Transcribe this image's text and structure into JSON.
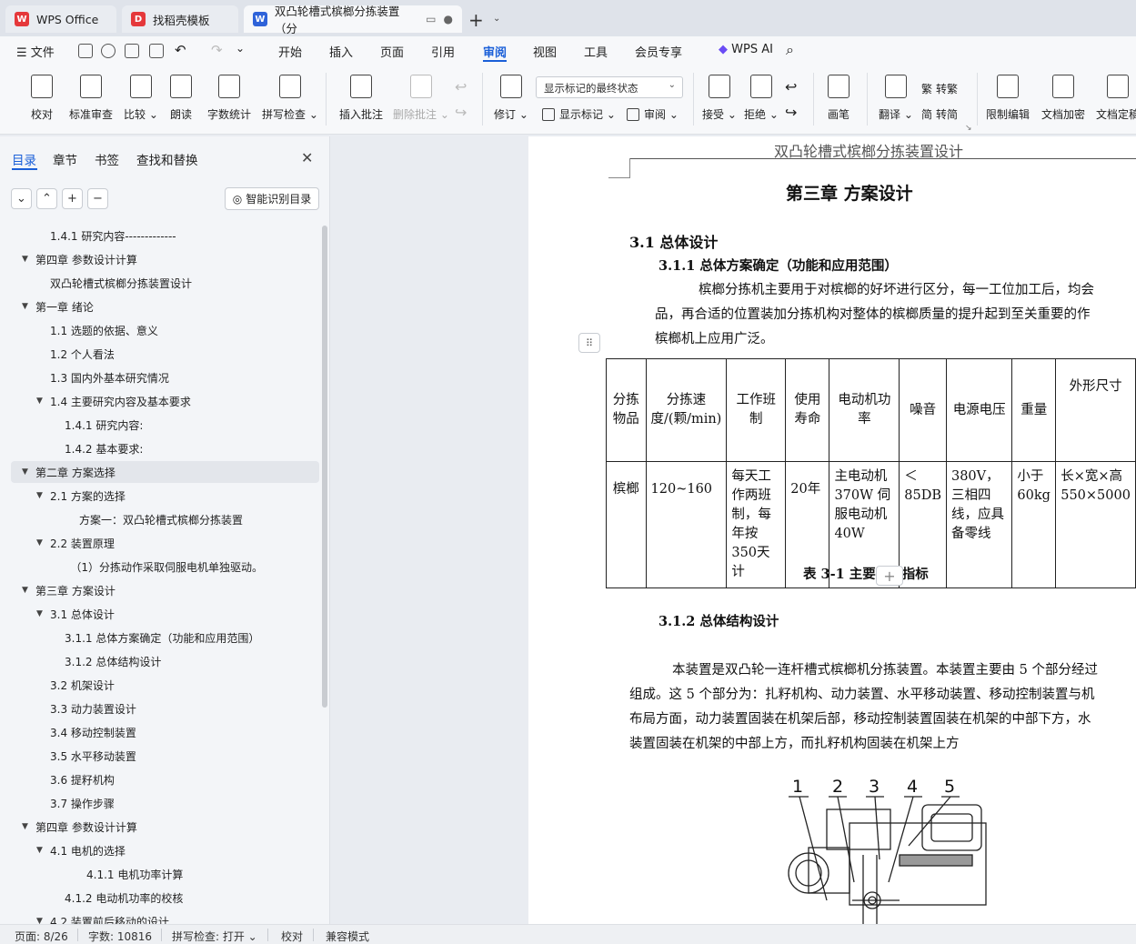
{
  "tabs": [
    {
      "label": "WPS Office",
      "logo": "W",
      "logo_color": "#e5383b"
    },
    {
      "label": "找稻壳模板",
      "logo": "D",
      "logo_color": "#e5383b"
    },
    {
      "label": "双凸轮槽式槟榔分拣装置（分",
      "logo": "W",
      "logo_color": "#2f63d9"
    }
  ],
  "menu": {
    "file": "文件",
    "items": [
      "开始",
      "插入",
      "页面",
      "引用",
      "审阅",
      "视图",
      "工具",
      "会员专享"
    ],
    "active": "审阅",
    "ai": "WPS AI"
  },
  "ribbon": {
    "proofread": "校对",
    "std_review": "标准审查",
    "compare": "比较",
    "read_aloud": "朗读",
    "word_count": "字数统计",
    "spell_check": "拼写检查",
    "insert_comment": "插入批注",
    "delete_comment": "删除批注",
    "revise": "修订",
    "markup_state": "显示标记的最终状态",
    "show_markup": "显示标记",
    "review": "审阅",
    "accept": "接受",
    "reject": "拒绝",
    "pen": "画笔",
    "translate": "翻译",
    "to_traditional": "转繁",
    "to_simplified": "转简",
    "restrict_edit": "限制编辑",
    "doc_encrypt": "文档加密",
    "doc_finalize": "文档定稿"
  },
  "panel": {
    "tabs": [
      "目录",
      "章节",
      "书签",
      "查找和替换"
    ],
    "smart_toc": "智能识别目录"
  },
  "toc": [
    {
      "text": "1.4.1  研究内容-------------",
      "level": 1,
      "tri": ""
    },
    {
      "text": "第四章   参数设计计算",
      "level": 0,
      "tri": "▼"
    },
    {
      "text": "双凸轮槽式槟榔分拣装置设计",
      "level": 1,
      "tri": ""
    },
    {
      "text": "第一章  绪论",
      "level": 0,
      "tri": "▼"
    },
    {
      "text": "1.1 选题的依据、意义",
      "level": 1,
      "tri": ""
    },
    {
      "text": "1.2   个人看法",
      "level": 1,
      "tri": ""
    },
    {
      "text": "1.3   国内外基本研究情况",
      "level": 1,
      "tri": ""
    },
    {
      "text": "1.4   主要研究内容及基本要求",
      "level": 1,
      "tri": "▼"
    },
    {
      "text": "1.4.1    研究内容:",
      "level": 2,
      "tri": ""
    },
    {
      "text": "1.4.2    基本要求:",
      "level": 2,
      "tri": ""
    },
    {
      "text": "第二章  方案选择",
      "level": 0,
      "tri": "▼"
    },
    {
      "text": "2.1  方案的选择",
      "level": 1,
      "tri": "▼"
    },
    {
      "text": "方案一：双凸轮槽式槟榔分拣装置",
      "level": 3,
      "tri": ""
    },
    {
      "text": "2.2  装置原理",
      "level": 1,
      "tri": "▼"
    },
    {
      "text": "（1）分拣动作采取伺服电机单独驱动。",
      "level": 2.4,
      "tri": ""
    },
    {
      "text": "第三章   方案设计",
      "level": 0,
      "tri": "▼"
    },
    {
      "text": "3.1    总体设计",
      "level": 1,
      "tri": "▼"
    },
    {
      "text": "3.1.1  总体方案确定（功能和应用范围）",
      "level": 2,
      "tri": ""
    },
    {
      "text": "3.1.2  总体结构设计",
      "level": 2,
      "tri": ""
    },
    {
      "text": "3.2    机架设计",
      "level": 1,
      "tri": ""
    },
    {
      "text": "3.3    动力装置设计",
      "level": 1,
      "tri": ""
    },
    {
      "text": "3.4    移动控制装置",
      "level": 1,
      "tri": ""
    },
    {
      "text": "3.5    水平移动装置",
      "level": 1,
      "tri": ""
    },
    {
      "text": "3.6    提籽机构",
      "level": 1,
      "tri": ""
    },
    {
      "text": "3.7    操作步骤",
      "level": 1,
      "tri": ""
    },
    {
      "text": "第四章  参数设计计算",
      "level": 0,
      "tri": "▼"
    },
    {
      "text": "4.1  电机的选择",
      "level": 1,
      "tri": "▼"
    },
    {
      "text": "4.1.1  电机功率计算",
      "level": 3.5,
      "tri": ""
    },
    {
      "text": "4.1.2  电动机功率的校核",
      "level": 2,
      "tri": ""
    },
    {
      "text": "4.2   装置前后移动的设计",
      "level": 1,
      "tri": "▼"
    }
  ],
  "toc_selected": "第二章  方案选择",
  "doc": {
    "header": "双凸轮槽式槟榔分拣装置设计",
    "chapter": "第三章    方案设计",
    "sec31": "3.1    总体设计",
    "sec311": "3.1.1  总体方案确定（功能和应用范围）",
    "p1_l1": "槟榔分拣机主要用于对槟榔的好坏进行区分，每一工位加工后，均会",
    "p1_l2": "品，再合适的位置装加分拣机构对整体的槟榔质量的提升起到至关重要的作",
    "p1_l3": "槟榔机上应用广泛。",
    "table_headers": [
      "分拣物品",
      "分拣速度/(颗/min)",
      "工作班制",
      "使用寿命",
      "电动机功率",
      "噪音",
      "电源电压",
      "重量",
      "外形尺寸"
    ],
    "table_row": [
      "槟榔",
      "120~160",
      "每天工作两班制，每年按350天计",
      "20年",
      "主电动机370W 伺服电动机40W",
      "＜85DB",
      "380V，三相四线，应具备零线",
      "小于60kg",
      "长×宽×高550×5000"
    ],
    "table_caption": "表 3-1 主要技术指标",
    "sec312": "3.1.2 总体结构设计",
    "p2_l1": "本装置是双凸轮一连杆槽式槟榔机分拣装置。本装置主要由 5 个部分经过",
    "p2_l2": "组成。这 5 个部分为：扎籽机构、动力装置、水平移动装置、移动控制装置与机",
    "p2_l3": "布局方面，动力装置固装在机架后部，移动控制装置固装在机架的中部下方，水",
    "p2_l4": "装置固装在机架的中部上方，而扎籽机构固装在机架上方",
    "fig_labels": [
      "1",
      "2",
      "3",
      "4",
      "5"
    ]
  },
  "status": {
    "page": "页面: 8/26",
    "words": "字数: 10816",
    "spell": "拼写检查: 打开",
    "proof": "校对",
    "compat": "兼容模式"
  }
}
